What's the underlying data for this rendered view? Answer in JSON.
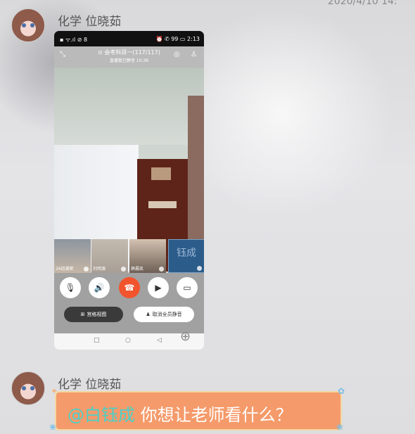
{
  "timestamp": "2020/4/10 14:",
  "messages": [
    {
      "sender": "化学 位晓茹"
    },
    {
      "sender": "化学 位晓茹",
      "mention": "@白钰成",
      "text": " 你想让老师看什么？"
    }
  ],
  "screenshot": {
    "status_left": "▪ ᯤ.ıl ⊘ 8",
    "status_right": "⏰ ✆ 99 ▭ 2:13",
    "call_title": "⊙ 会考科目一(117/117)",
    "call_subtitle": "直播暂已静音  10:36",
    "participants": [
      {
        "name": "26班满荣"
      },
      {
        "name": "刘明源"
      },
      {
        "name": "薛晨凯"
      },
      {
        "name": "",
        "avatar_text": "钰成"
      }
    ],
    "grid_view_label": "宫格视图",
    "unmute_all_label": "取消全员静音",
    "nav": {
      "back": "◁",
      "home": "○",
      "recent": "□"
    }
  },
  "colors": {
    "end_call": "#f2542d",
    "bubble": "#f59a6a",
    "mention": "#4ad0c8"
  }
}
